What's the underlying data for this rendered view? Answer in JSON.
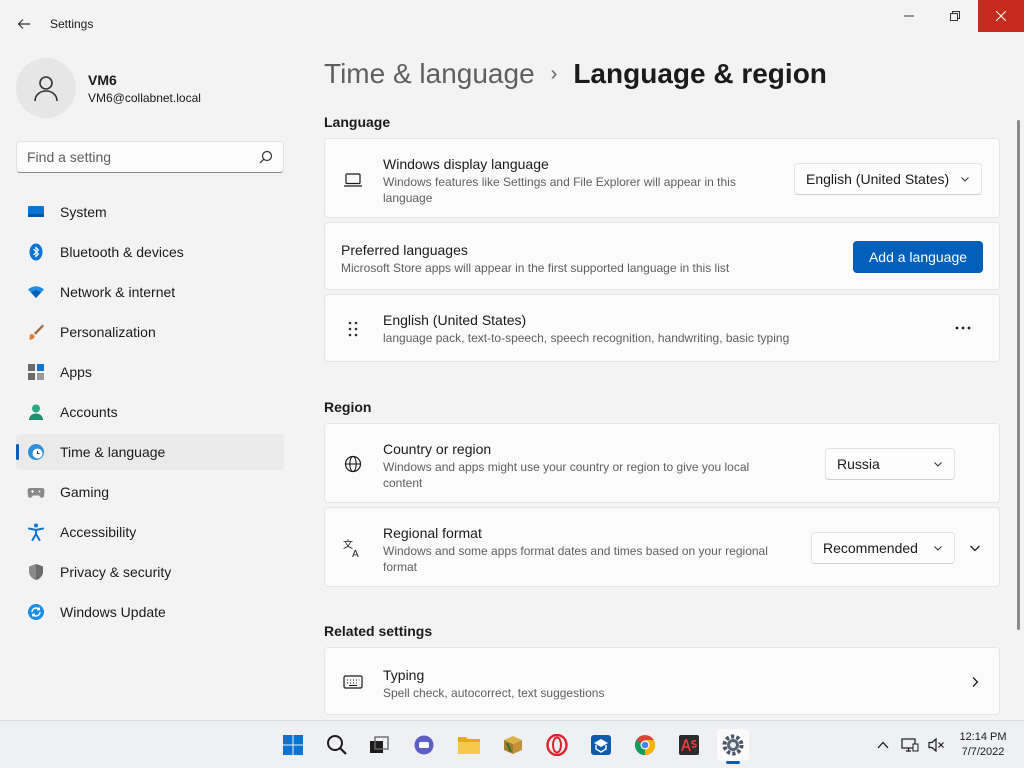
{
  "titlebar": {
    "app_title": "Settings",
    "icons": {
      "back": "back-arrow-icon",
      "minimize": "minimize-icon",
      "maximize": "maximize-icon",
      "close": "close-icon"
    }
  },
  "profile": {
    "name": "VM6",
    "email": "VM6@collabnet.local"
  },
  "search": {
    "placeholder": "Find a setting"
  },
  "sidebar": {
    "items": [
      {
        "label": "System",
        "icon": "system-icon"
      },
      {
        "label": "Bluetooth & devices",
        "icon": "bluetooth-icon"
      },
      {
        "label": "Network & internet",
        "icon": "network-icon"
      },
      {
        "label": "Personalization",
        "icon": "brush-icon"
      },
      {
        "label": "Apps",
        "icon": "apps-icon"
      },
      {
        "label": "Accounts",
        "icon": "accounts-icon"
      },
      {
        "label": "Time & language",
        "icon": "time-language-icon",
        "active": true
      },
      {
        "label": "Gaming",
        "icon": "gaming-icon"
      },
      {
        "label": "Accessibility",
        "icon": "accessibility-icon"
      },
      {
        "label": "Privacy & security",
        "icon": "shield-icon"
      },
      {
        "label": "Windows Update",
        "icon": "update-icon"
      }
    ]
  },
  "breadcrumb": {
    "parent": "Time & language",
    "separator": "›",
    "current": "Language & region"
  },
  "language_section": {
    "title": "Language",
    "display_language": {
      "title": "Windows display language",
      "desc_line1": "Windows features like Settings and File Explorer will appear in this",
      "desc_line2": "language",
      "selected": "English (United States)"
    },
    "preferred": {
      "title": "Preferred languages",
      "desc": "Microsoft Store apps will appear in the first supported language in this list",
      "button": "Add a language"
    },
    "english": {
      "title": "English (United States)",
      "desc": "language pack, text-to-speech, speech recognition, handwriting, basic typing",
      "more": "···"
    }
  },
  "region_section": {
    "title": "Region",
    "country": {
      "title": "Country or region",
      "desc_line1": "Windows and apps might use your country or region to give you local",
      "desc_line2": "content",
      "selected": "Russia"
    },
    "format": {
      "title": "Regional format",
      "desc_line1": "Windows and some apps format dates and times based on your regional",
      "desc_line2": "format",
      "selected": "Recommended"
    }
  },
  "related_section": {
    "title": "Related settings",
    "typing": {
      "title": "Typing",
      "desc": "Spell check, autocorrect, text suggestions"
    }
  },
  "taskbar": {
    "apps": [
      "start-icon",
      "search-icon",
      "task-view-icon",
      "chat-icon",
      "file-explorer-icon",
      "app-icon",
      "opera-icon",
      "app-icon",
      "chrome-icon",
      "app-icon",
      "settings-icon"
    ],
    "time": "12:14 PM",
    "date": "7/7/2022"
  },
  "colors": {
    "accent": "#005fb8",
    "close_hover": "#c42b1c",
    "background": "#f3f3f3",
    "card": "#fbfbfb"
  }
}
